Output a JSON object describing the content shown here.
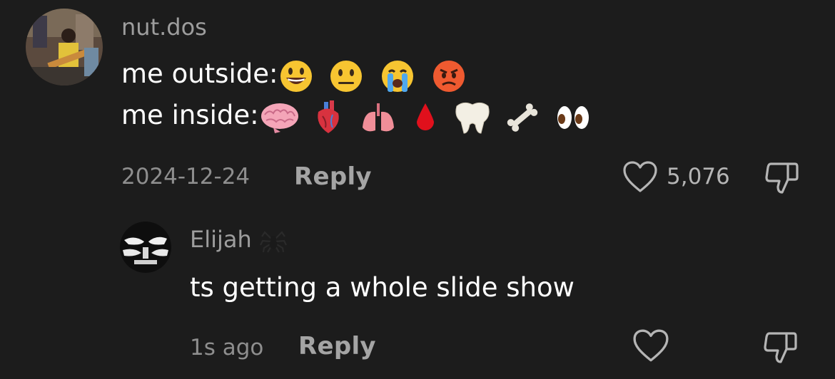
{
  "comments": [
    {
      "username": "nut.dos",
      "line1_text": "me outside:",
      "line1_emojis": [
        "grinning-face",
        "neutral-face",
        "loudly-crying-face",
        "angry-face"
      ],
      "line2_text": "me inside:",
      "line2_emojis": [
        "brain",
        "anatomical-heart",
        "lungs",
        "drop-of-blood",
        "tooth",
        "bone",
        "eyes"
      ],
      "date": "2024-12-24",
      "reply_label": "Reply",
      "likes": "5,076"
    },
    {
      "username": "Elijah",
      "username_emoji": "spider",
      "text": "ts getting a whole slide show",
      "time": "1s ago",
      "reply_label": "Reply"
    }
  ],
  "icons": {
    "like": "heart-outline-icon",
    "dislike": "thumbs-down-outline-icon"
  },
  "colors": {
    "background": "#1c1c1c",
    "username": "#9d9d9d",
    "meta": "#8e8e8e",
    "reply": "#a4a4a4",
    "text": "#ffffff"
  }
}
